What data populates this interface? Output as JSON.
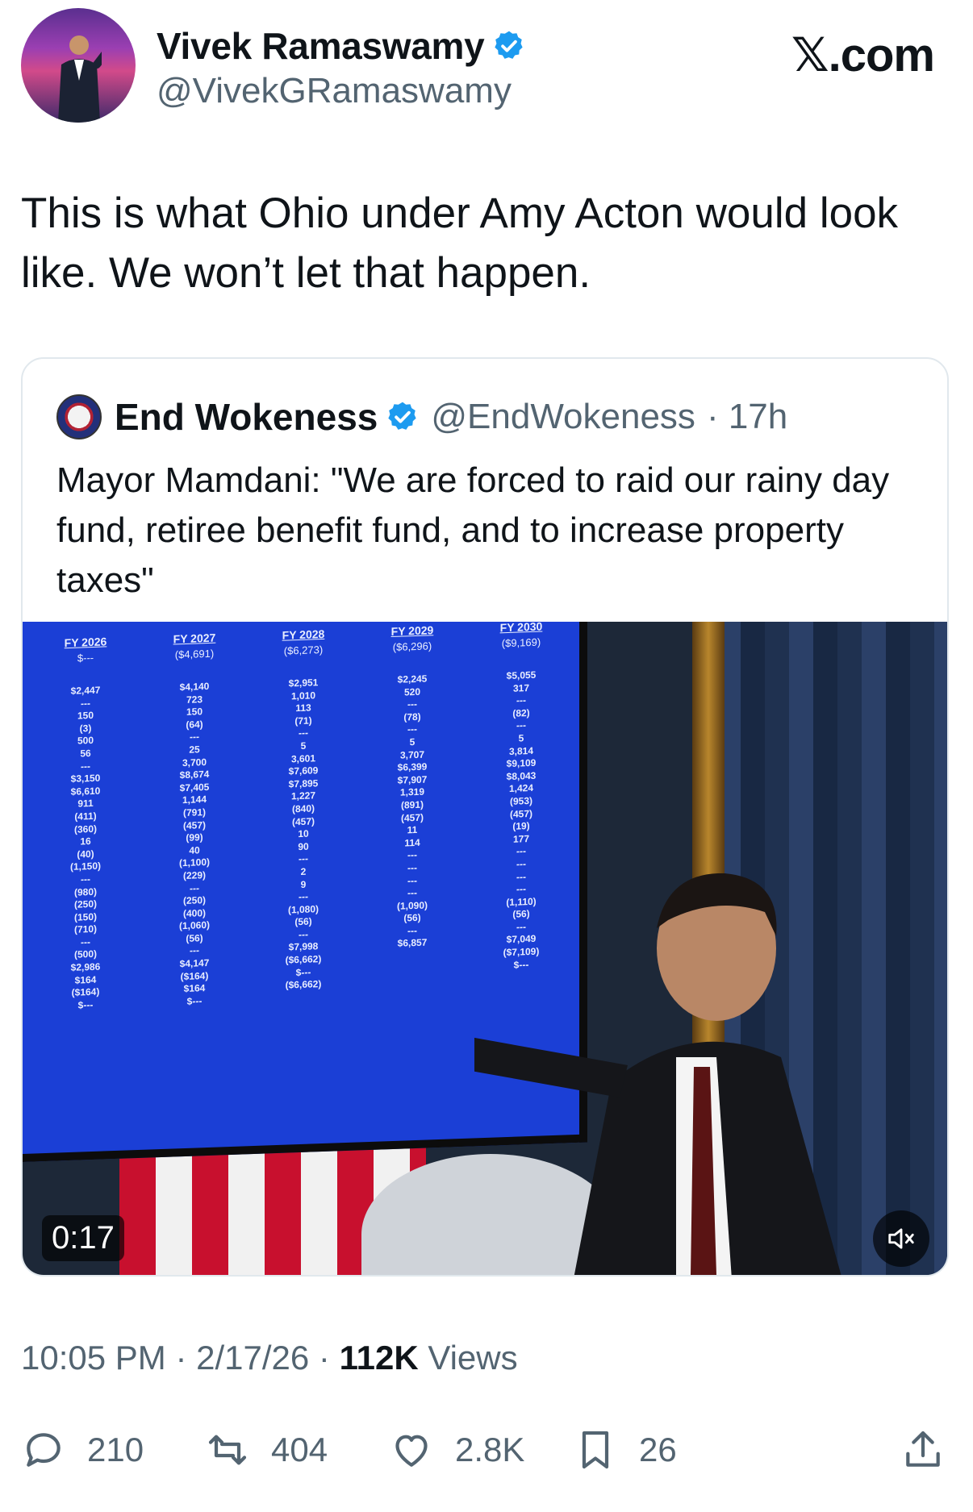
{
  "author": {
    "name": "Vivek Ramaswamy",
    "handle": "@VivekGRamaswamy",
    "verified_color": "#1d9bf0"
  },
  "brand": "𝕏.com",
  "tweet": {
    "text": "This is what Ohio under Amy Acton would look like. We won’t let that happen."
  },
  "quote": {
    "name": "End Wokeness",
    "handle": "@EndWokeness",
    "age": "· 17h",
    "text": "Mayor Mamdani: \"We are forced to raid our rainy day fund, retiree benefit fund, and to increase property taxes\"",
    "video": {
      "duration": "0:17",
      "mute_icon": "speaker-muted-icon",
      "screen_columns": [
        {
          "header": "FY 2026",
          "top": "$---",
          "values": [
            "$2,447",
            "---",
            "150",
            "(3)",
            "500",
            "56",
            "---",
            "$3,150",
            "$6,610",
            "911",
            "(411)",
            "(360)",
            "16",
            "(40)",
            "(1,150)",
            "---",
            "(980)",
            "(250)",
            "(150)",
            "(710)",
            "---",
            "(500)",
            "$2,986",
            "$164",
            "($164)",
            "$---"
          ]
        },
        {
          "header": "FY 2027",
          "top": "($4,691)",
          "values": [
            "$4,140",
            "723",
            "150",
            "(64)",
            "---",
            "25",
            "3,700",
            "$8,674",
            "$7,405",
            "1,144",
            "(791)",
            "(457)",
            "(99)",
            "40",
            "(1,100)",
            "(229)",
            "---",
            "(250)",
            "(400)",
            "(1,060)",
            "(56)",
            "---",
            "$4,147",
            "($164)",
            "$164",
            "$---"
          ]
        },
        {
          "header": "FY 2028",
          "top": "($6,273)",
          "values": [
            "$2,951",
            "1,010",
            "113",
            "(71)",
            "---",
            "5",
            "3,601",
            "$7,609",
            "$7,895",
            "1,227",
            "(840)",
            "(457)",
            "10",
            "90",
            "---",
            "2",
            "9",
            "---",
            "(1,080)",
            "(56)",
            "---",
            "$7,998",
            "($6,662)",
            "$---",
            "($6,662)"
          ]
        },
        {
          "header": "FY 2029",
          "top": "($6,296)",
          "values": [
            "$2,245",
            "520",
            "---",
            "(78)",
            "---",
            "5",
            "3,707",
            "$6,399",
            "$7,907",
            "1,319",
            "(891)",
            "(457)",
            "11",
            "114",
            "---",
            "---",
            "---",
            "---",
            "(1,090)",
            "(56)",
            "---",
            "$6,857"
          ]
        },
        {
          "header": "FY 2030",
          "top": "($9,169)",
          "values": [
            "$5,055",
            "317",
            "---",
            "(82)",
            "---",
            "5",
            "3,814",
            "$9,109",
            "$8,043",
            "1,424",
            "(953)",
            "(457)",
            "(19)",
            "177",
            "---",
            "---",
            "---",
            "---",
            "(1,110)",
            "(56)",
            "---",
            "$7,049",
            "($7,109)",
            "$---"
          ]
        }
      ]
    }
  },
  "meta": {
    "time": "10:05 PM · 2/17/26 ·",
    "views_count": "112K",
    "views_label": "Views"
  },
  "actions": {
    "replies": "210",
    "reposts": "404",
    "likes": "2.8K",
    "bookmarks": "26"
  }
}
